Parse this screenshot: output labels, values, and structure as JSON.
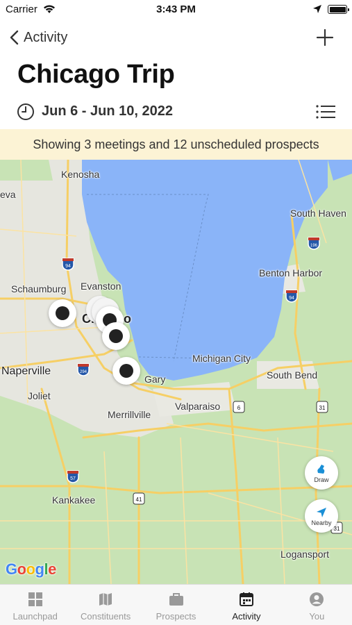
{
  "status_bar": {
    "carrier": "Carrier",
    "time": "3:43 PM"
  },
  "nav": {
    "back_label": "Activity"
  },
  "trip": {
    "title": "Chicago Trip",
    "date_range": "Jun 6 - Jun 10, 2022"
  },
  "banner": {
    "text": "Showing 3 meetings and 12 unscheduled prospects"
  },
  "map": {
    "labels": {
      "kenosha": "Kenosha",
      "geneva": "eva",
      "schaumburg": "Schaumburg",
      "evanston": "Evanston",
      "chicago": "Chicago",
      "naperville": "Naperville",
      "joliet": "Joliet",
      "gary": "Gary",
      "merrillville": "Merrillville",
      "valparaiso": "Valparaiso",
      "michigan_city": "Michigan City",
      "south_bend": "South Bend",
      "south_haven": "South Haven",
      "benton_harbor": "Benton Harbor",
      "kankakee": "Kankakee",
      "logansport": "Logansport"
    },
    "highways": [
      "94",
      "196",
      "94",
      "294",
      "6",
      "31",
      "57",
      "41",
      "31"
    ],
    "draw_label": "Draw",
    "nearby_label": "Nearby",
    "attribution": "Google"
  },
  "tabs": [
    {
      "label": "Launchpad",
      "icon": "grid-icon",
      "active": false
    },
    {
      "label": "Constituents",
      "icon": "map-icon",
      "active": false
    },
    {
      "label": "Prospects",
      "icon": "briefcase-icon",
      "active": false
    },
    {
      "label": "Activity",
      "icon": "calendar-icon",
      "active": true
    },
    {
      "label": "You",
      "icon": "person-icon",
      "active": false
    }
  ],
  "colors": {
    "water": "#8ab4f8",
    "land": "#c8e3b5",
    "urban": "#e8e8e3",
    "banner": "#fcf3d5",
    "road": "#f6cf65"
  }
}
